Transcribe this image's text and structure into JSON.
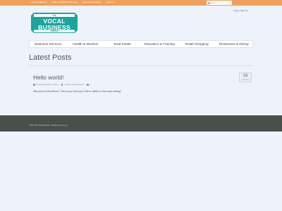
{
  "topbar": {
    "links": [
      "Help Your Business",
      "Grow Your Business With Vocal",
      "Get Your Listing Today",
      "Contact Us"
    ],
    "search_placeholder": "Search..."
  },
  "account": {
    "login_label": "Login | Sign Up"
  },
  "logo": {
    "top": "THE",
    "line1": "VOCAL",
    "line2": "BUSINESS",
    "bottom": "COMPANY",
    "color": "#1ba59f"
  },
  "nav": {
    "items": [
      "Business Services",
      "Health & Medical",
      "Real Estate",
      "Education & Training",
      "Retail Shopping",
      "Restaurant & Dining"
    ]
  },
  "main": {
    "title": "Latest Posts"
  },
  "post": {
    "title": "Hello world!",
    "date_day": "16",
    "date_month": "Jun 2021",
    "meta_author": "by thevocalbusiness_admin",
    "meta_category": "posted in Uncategorized",
    "meta_comments": "1",
    "excerpt": "Welcome to WordPress. This is your first post. Edit or delete it, then start writing!"
  },
  "footer": {
    "text": "© 2021 The Vocal Business · WordPress Theme by"
  },
  "colors": {
    "topbar": "#f0a05a",
    "footer": "#47514a",
    "background": "#eef3fb"
  }
}
